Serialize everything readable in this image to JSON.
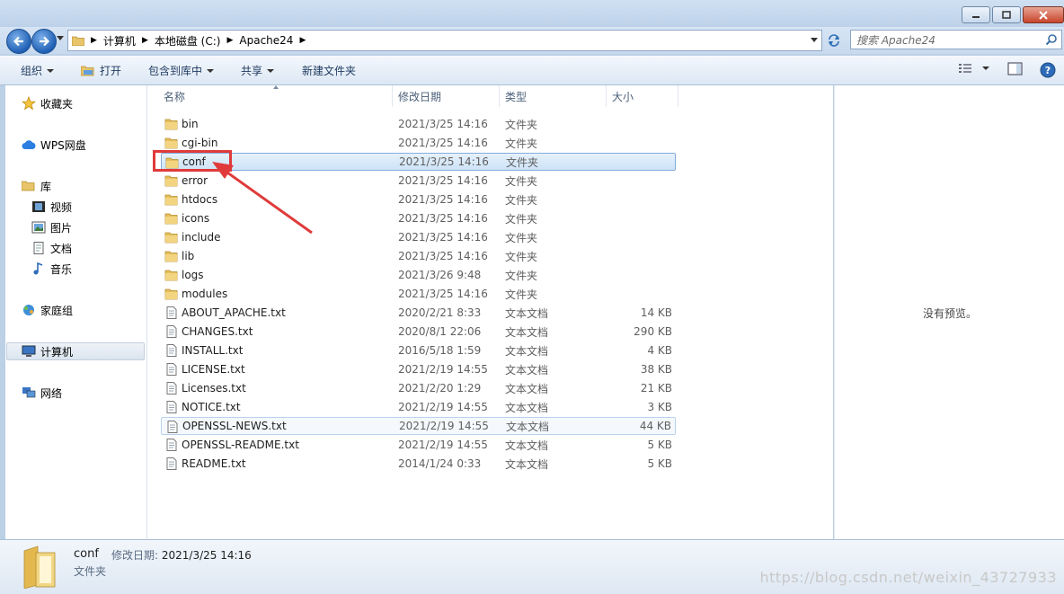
{
  "address": {
    "segments": [
      "计算机",
      "本地磁盘 (C:)",
      "Apache24"
    ]
  },
  "search": {
    "placeholder": "搜索 Apache24"
  },
  "toolbar": {
    "organize": "组织",
    "open": "打开",
    "include_in_library": "包含到库中",
    "share": "共享",
    "new_folder": "新建文件夹"
  },
  "nav": {
    "favorites": "收藏夹",
    "wps": "WPS网盘",
    "library": "库",
    "videos": "视频",
    "pictures": "图片",
    "documents": "文档",
    "music": "音乐",
    "homegroup": "家庭组",
    "computer": "计算机",
    "network": "网络"
  },
  "columns": {
    "name": "名称",
    "date": "修改日期",
    "type": "类型",
    "size": "大小"
  },
  "files": [
    {
      "name": "bin",
      "date": "2021/3/25 14:16",
      "type": "文件夹",
      "size": "",
      "kind": "folder"
    },
    {
      "name": "cgi-bin",
      "date": "2021/3/25 14:16",
      "type": "文件夹",
      "size": "",
      "kind": "folder"
    },
    {
      "name": "conf",
      "date": "2021/3/25 14:16",
      "type": "文件夹",
      "size": "",
      "kind": "folder",
      "selected": true
    },
    {
      "name": "error",
      "date": "2021/3/25 14:16",
      "type": "文件夹",
      "size": "",
      "kind": "folder"
    },
    {
      "name": "htdocs",
      "date": "2021/3/25 14:16",
      "type": "文件夹",
      "size": "",
      "kind": "folder"
    },
    {
      "name": "icons",
      "date": "2021/3/25 14:16",
      "type": "文件夹",
      "size": "",
      "kind": "folder"
    },
    {
      "name": "include",
      "date": "2021/3/25 14:16",
      "type": "文件夹",
      "size": "",
      "kind": "folder"
    },
    {
      "name": "lib",
      "date": "2021/3/25 14:16",
      "type": "文件夹",
      "size": "",
      "kind": "folder"
    },
    {
      "name": "logs",
      "date": "2021/3/26 9:48",
      "type": "文件夹",
      "size": "",
      "kind": "folder"
    },
    {
      "name": "modules",
      "date": "2021/3/25 14:16",
      "type": "文件夹",
      "size": "",
      "kind": "folder"
    },
    {
      "name": "ABOUT_APACHE.txt",
      "date": "2020/2/21 8:33",
      "type": "文本文档",
      "size": "14 KB",
      "kind": "text"
    },
    {
      "name": "CHANGES.txt",
      "date": "2020/8/1 22:06",
      "type": "文本文档",
      "size": "290 KB",
      "kind": "text"
    },
    {
      "name": "INSTALL.txt",
      "date": "2016/5/18 1:59",
      "type": "文本文档",
      "size": "4 KB",
      "kind": "text"
    },
    {
      "name": "LICENSE.txt",
      "date": "2021/2/19 14:55",
      "type": "文本文档",
      "size": "38 KB",
      "kind": "text"
    },
    {
      "name": "Licenses.txt",
      "date": "2021/2/20 1:29",
      "type": "文本文档",
      "size": "21 KB",
      "kind": "text"
    },
    {
      "name": "NOTICE.txt",
      "date": "2021/2/19 14:55",
      "type": "文本文档",
      "size": "3 KB",
      "kind": "text"
    },
    {
      "name": "OPENSSL-NEWS.txt",
      "date": "2021/2/19 14:55",
      "type": "文本文档",
      "size": "44 KB",
      "kind": "text",
      "hover": true
    },
    {
      "name": "OPENSSL-README.txt",
      "date": "2021/2/19 14:55",
      "type": "文本文档",
      "size": "5 KB",
      "kind": "text"
    },
    {
      "name": "README.txt",
      "date": "2014/1/24 0:33",
      "type": "文本文档",
      "size": "5 KB",
      "kind": "text"
    }
  ],
  "preview": {
    "text": "没有预览。"
  },
  "details": {
    "name": "conf",
    "modified_label": "修改日期:",
    "modified_value": "2021/3/25 14:16",
    "type": "文件夹"
  },
  "watermark": "https://blog.csdn.net/weixin_43727933",
  "colors": {
    "highlight": "#e03a3a",
    "selection": "#cde3f7"
  }
}
